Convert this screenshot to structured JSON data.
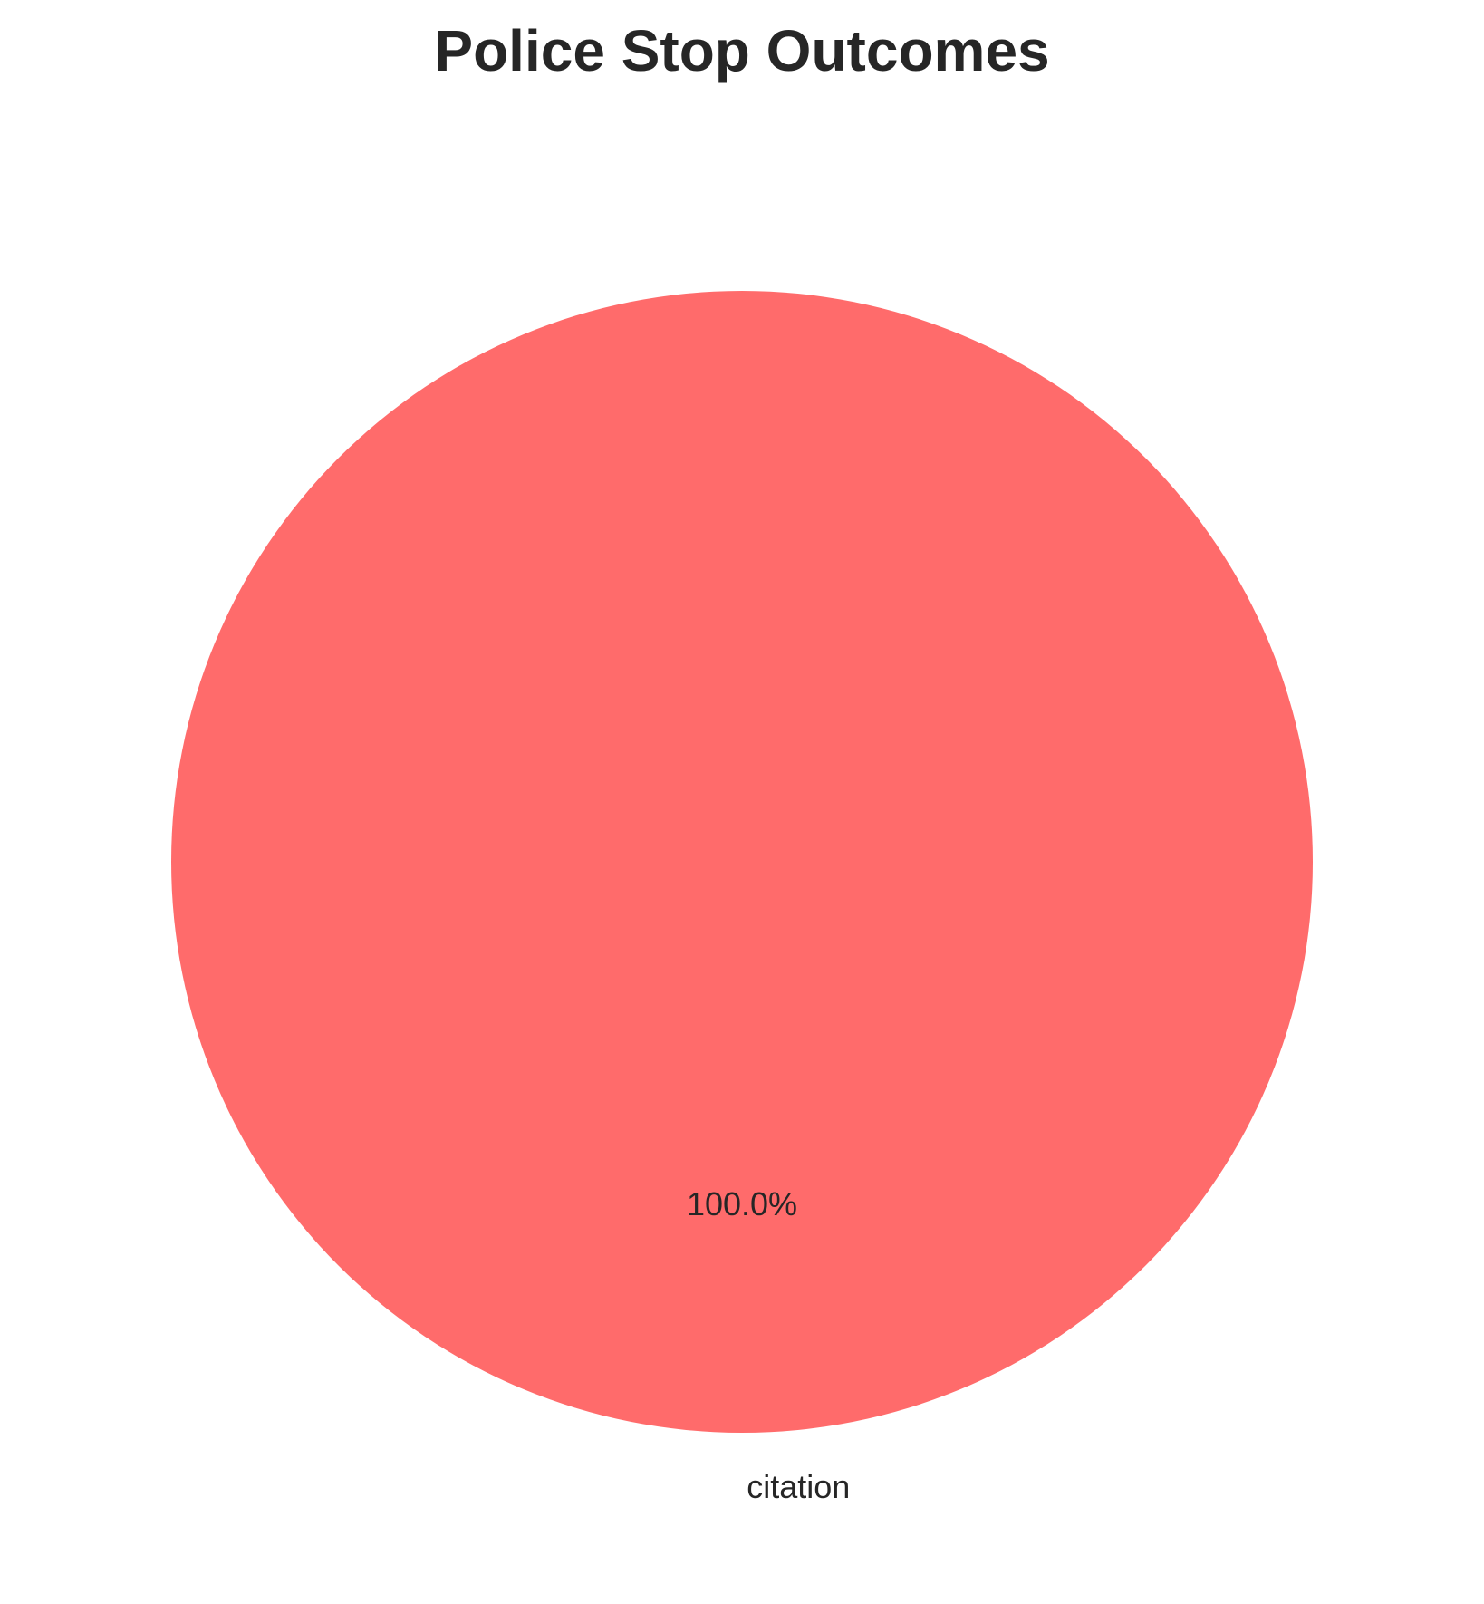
{
  "chart_data": {
    "type": "pie",
    "title": "Police Stop Outcomes",
    "categories": [
      "citation"
    ],
    "values": [
      100.0
    ],
    "value_labels": [
      "100.0%"
    ],
    "colors": [
      "#ff6b6b"
    ],
    "legend": "none"
  }
}
